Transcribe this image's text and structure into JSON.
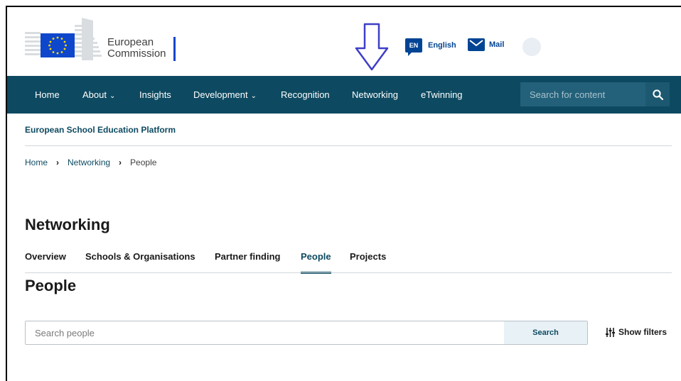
{
  "header": {
    "logo_text_line1": "European",
    "logo_text_line2": "Commission",
    "language_code": "EN",
    "language_label": "English",
    "mail_label": "Mail"
  },
  "nav": {
    "items": [
      {
        "label": "Home"
      },
      {
        "label": "About",
        "dropdown": true
      },
      {
        "label": "Insights"
      },
      {
        "label": "Development",
        "dropdown": true
      },
      {
        "label": "Recognition"
      },
      {
        "label": "Networking"
      },
      {
        "label": "eTwinning"
      }
    ],
    "search_placeholder": "Search for content"
  },
  "platform_title": "European School Education Platform",
  "breadcrumb": [
    "Home",
    "Networking",
    "People"
  ],
  "page_title": "Networking",
  "tabs": [
    {
      "label": "Overview"
    },
    {
      "label": "Schools & Organisations"
    },
    {
      "label": "Partner finding"
    },
    {
      "label": "People",
      "active": true
    },
    {
      "label": "Projects"
    }
  ],
  "section_title": "People",
  "people_search": {
    "placeholder": "Search people",
    "button_label": "Search"
  },
  "filters_label": "Show filters",
  "colors": {
    "nav_bg": "#0d4a61",
    "accent": "#004494",
    "arrow": "#3f3fc8"
  }
}
